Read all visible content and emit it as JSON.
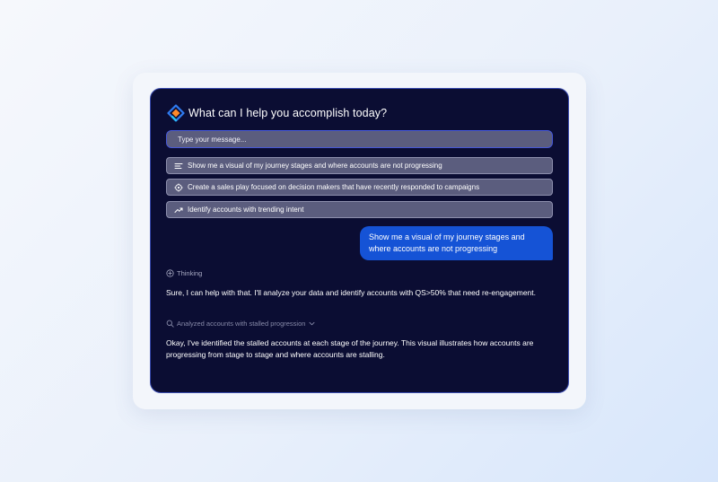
{
  "header": {
    "title": "What can I help you accomplish today?",
    "logo_icon": "brand-logo-icon"
  },
  "input": {
    "placeholder": "Type your message...",
    "value": ""
  },
  "suggestions": [
    {
      "icon": "list-bars-icon",
      "label": "Show me a visual of my journey stages and where accounts are not progressing"
    },
    {
      "icon": "target-icon",
      "label": "Create a sales play focused on decision makers that have recently responded to campaigns"
    },
    {
      "icon": "trending-up-icon",
      "label": "Identify accounts with trending intent"
    }
  ],
  "conversation": {
    "user_message": "Show me a visual of my journey stages and where accounts are not progressing",
    "thinking_label": "Thinking",
    "assistant_reply_1": "Sure, I can help with that. I'll analyze your data and identify accounts with QS>50% that need re-engagement.",
    "analysis_step_label": "Analyzed accounts with stalled progression",
    "assistant_reply_2": "Okay, I've identified the stalled accounts at each stage of the journey. This visual illustrates how accounts are progressing from stage to stage and where accounts are stalling."
  },
  "colors": {
    "panel_bg": "#0b0d33",
    "accent_blue": "#1553d6",
    "suggestion_bg": "#5b5d7e",
    "input_border": "#4658d8"
  }
}
